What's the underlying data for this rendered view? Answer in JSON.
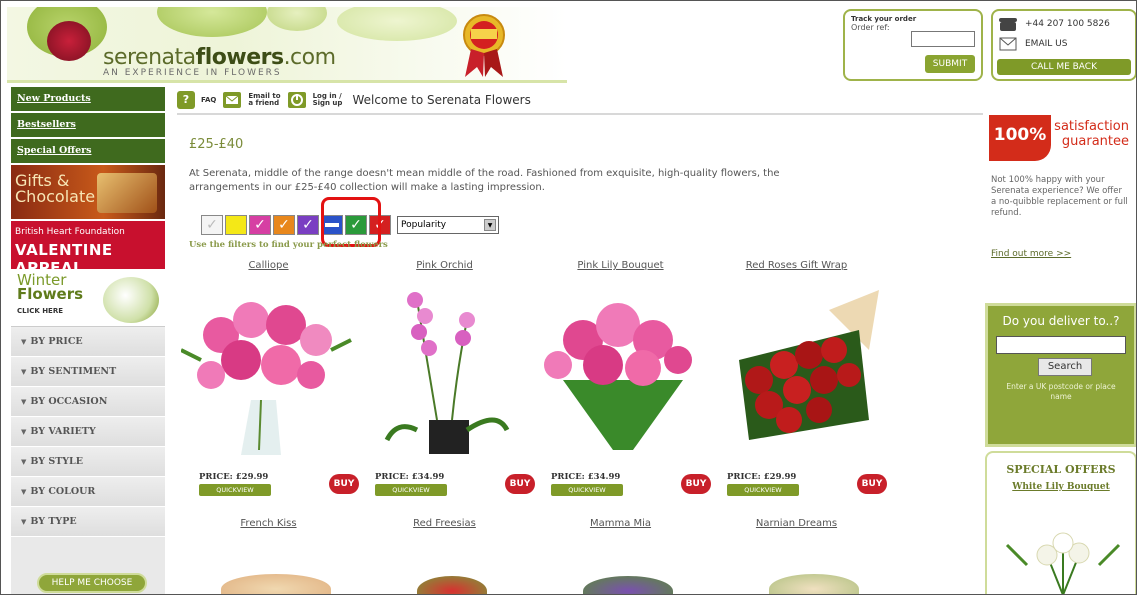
{
  "brand": {
    "name_plain": "serenata",
    "name_bold": "flowers",
    "name_suffix": ".com",
    "tagline": "AN EXPERIENCE IN FLOWERS"
  },
  "track": {
    "title": "Track your order",
    "label": "Order ref:",
    "value": "",
    "submit_label": "SUBMIT"
  },
  "contact": {
    "phone": "+44 207 100 5826",
    "email_label": "EMAIL US",
    "callback_label": "CALL ME BACK"
  },
  "leftnav": {
    "links": [
      "New Products",
      "Bestsellers",
      "Special Offers"
    ],
    "gifts_banner": {
      "line1": "Gifts &",
      "line2": "Chocolate"
    },
    "bhf_banner": {
      "line1": "British Heart Foundation",
      "line2": "VALENTINE APPEAL"
    },
    "winter_banner": {
      "line1": "Winter",
      "line2": "Flowers",
      "line3": "CLICK HERE"
    },
    "filters": [
      "BY PRICE",
      "BY SENTIMENT",
      "BY OCCASION",
      "BY VARIETY",
      "BY STYLE",
      "BY COLOUR",
      "BY TYPE"
    ],
    "help_label": "HELP ME CHOOSE"
  },
  "topbar": {
    "faq_label": "FAQ",
    "email_friend_line1": "Email to",
    "email_friend_line2": "a friend",
    "login_line1": "Log in /",
    "login_line2": "Sign up",
    "welcome": "Welcome to Serenata Flowers"
  },
  "main": {
    "title": "£25-£40",
    "intro": "At Serenata, middle of the range doesn't mean middle of the road. Fashioned from exquisite, high-quality flowers, the arrangements in our £25-£40 collection will make a lasting impression.",
    "filter_hint": "Use the filters to find your perfect flowers",
    "sort": {
      "selected": "Popularity"
    },
    "colors": {
      "white": "#ffffff",
      "yellow": "#f4e817",
      "pink": "#d63fa3",
      "orange": "#e8871c",
      "purple": "#7a3ec2",
      "blue": "#2a52c8",
      "green": "#2a9a3a",
      "red": "#d42020",
      "highlight": "#e31212",
      "accent": "#7f9a28"
    }
  },
  "products": [
    {
      "name": "Calliope",
      "price": "PRICE: £29.99",
      "quickview": "QUICKVIEW",
      "buy": "BUY"
    },
    {
      "name": "Pink Orchid",
      "price": "PRICE: £34.99",
      "quickview": "QUICKVIEW",
      "buy": "BUY"
    },
    {
      "name": "Pink Lily Bouquet",
      "price": "PRICE: £34.99",
      "quickview": "QUICKVIEW",
      "buy": "BUY"
    },
    {
      "name": "Red Roses Gift Wrap",
      "price": "PRICE: £29.99",
      "quickview": "QUICKVIEW",
      "buy": "BUY"
    }
  ],
  "products_row2": [
    "French Kiss",
    "Red Freesias",
    "Mamma Mia",
    "Narnian Dreams"
  ],
  "right": {
    "guarantee_pct": "100%",
    "guarantee_line1": "satisfaction",
    "guarantee_line2": "guarantee",
    "guarantee_text": "Not 100% happy with your Serenata experience? We offer a no-quibble replacement or full refund.",
    "find_out_more": "Find out more >>",
    "deliver_title": "Do you deliver to..?",
    "deliver_value": "",
    "search_label": "Search",
    "deliver_hint": "Enter a UK postcode or place name",
    "special_title": "SPECIAL OFFERS",
    "special_product": "White Lily Bouquet"
  }
}
